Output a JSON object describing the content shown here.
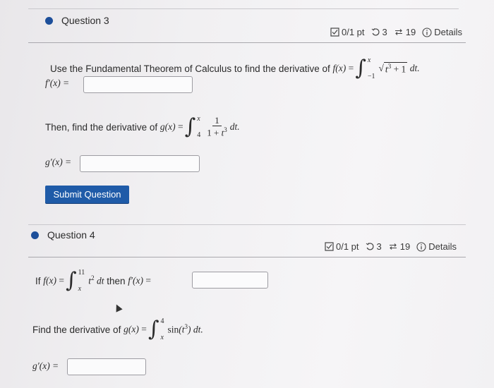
{
  "q3": {
    "title": "Question 3",
    "points": "0/1 pt",
    "retries": "3",
    "attempts": "19",
    "details": "Details",
    "prompt1": "Use the Fundamental Theorem of Calculus to find the derivative of",
    "f_label": "f′(x) =",
    "prompt2": "Then, find the derivative of",
    "g_label": "g′(x) =",
    "submit": "Submit Question"
  },
  "q4": {
    "title": "Question 4",
    "points": "0/1 pt",
    "retries": "3",
    "attempts": "19",
    "details": "Details",
    "prompt1_if": "If",
    "prompt1_then": "then",
    "prompt2": "Find the derivative of",
    "g_label": "g′(x) ="
  },
  "icons": {
    "points": "check-box-icon",
    "retries": "retry-icon",
    "attempts": "attempts-icon",
    "details": "info-icon"
  },
  "colors": {
    "accent": "#1f5ba8",
    "dot": "#1d4f9a"
  }
}
